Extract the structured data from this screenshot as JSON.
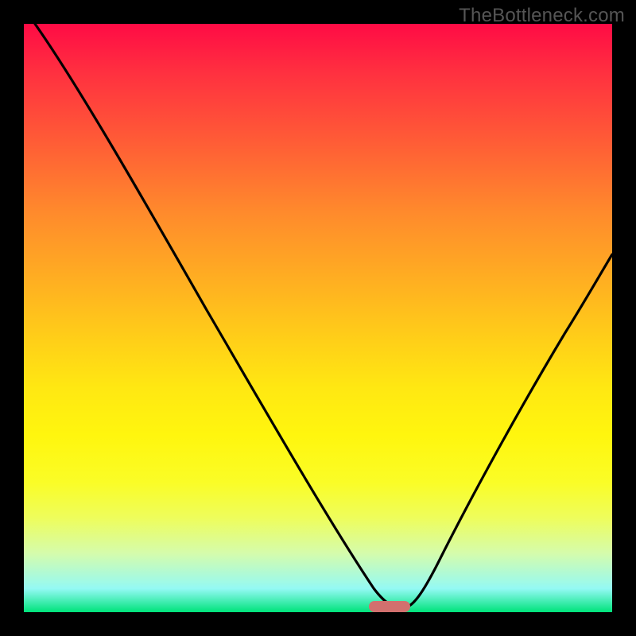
{
  "watermark": "TheBottleneck.com",
  "colors": {
    "frame_bg": "#000000",
    "marker": "#d2706e",
    "curve": "#000000",
    "watermark": "#555555",
    "gradient_top": "#ff0b45",
    "gradient_bottom": "#00e37b"
  },
  "chart_data": {
    "type": "line",
    "title": "",
    "xlabel": "",
    "ylabel": "",
    "xlim": [
      0,
      100
    ],
    "ylim": [
      0,
      100
    ],
    "grid": false,
    "series": [
      {
        "name": "curve",
        "x": [
          2,
          5,
          10,
          15,
          20,
          25,
          30,
          35,
          40,
          45,
          50,
          55,
          60,
          61,
          63,
          65,
          67,
          70,
          75,
          80,
          85,
          90,
          95,
          100
        ],
        "y": [
          100,
          95,
          86.5,
          78,
          69.5,
          61.5,
          53.5,
          46,
          38.5,
          31,
          23.5,
          15.5,
          6,
          3.5,
          0.8,
          0.2,
          1.5,
          6,
          16,
          26,
          35.5,
          44.5,
          53,
          61
        ]
      }
    ],
    "marker": {
      "x": 62.5,
      "y": 1.2,
      "shape": "pill",
      "color": "#d2706e"
    }
  }
}
